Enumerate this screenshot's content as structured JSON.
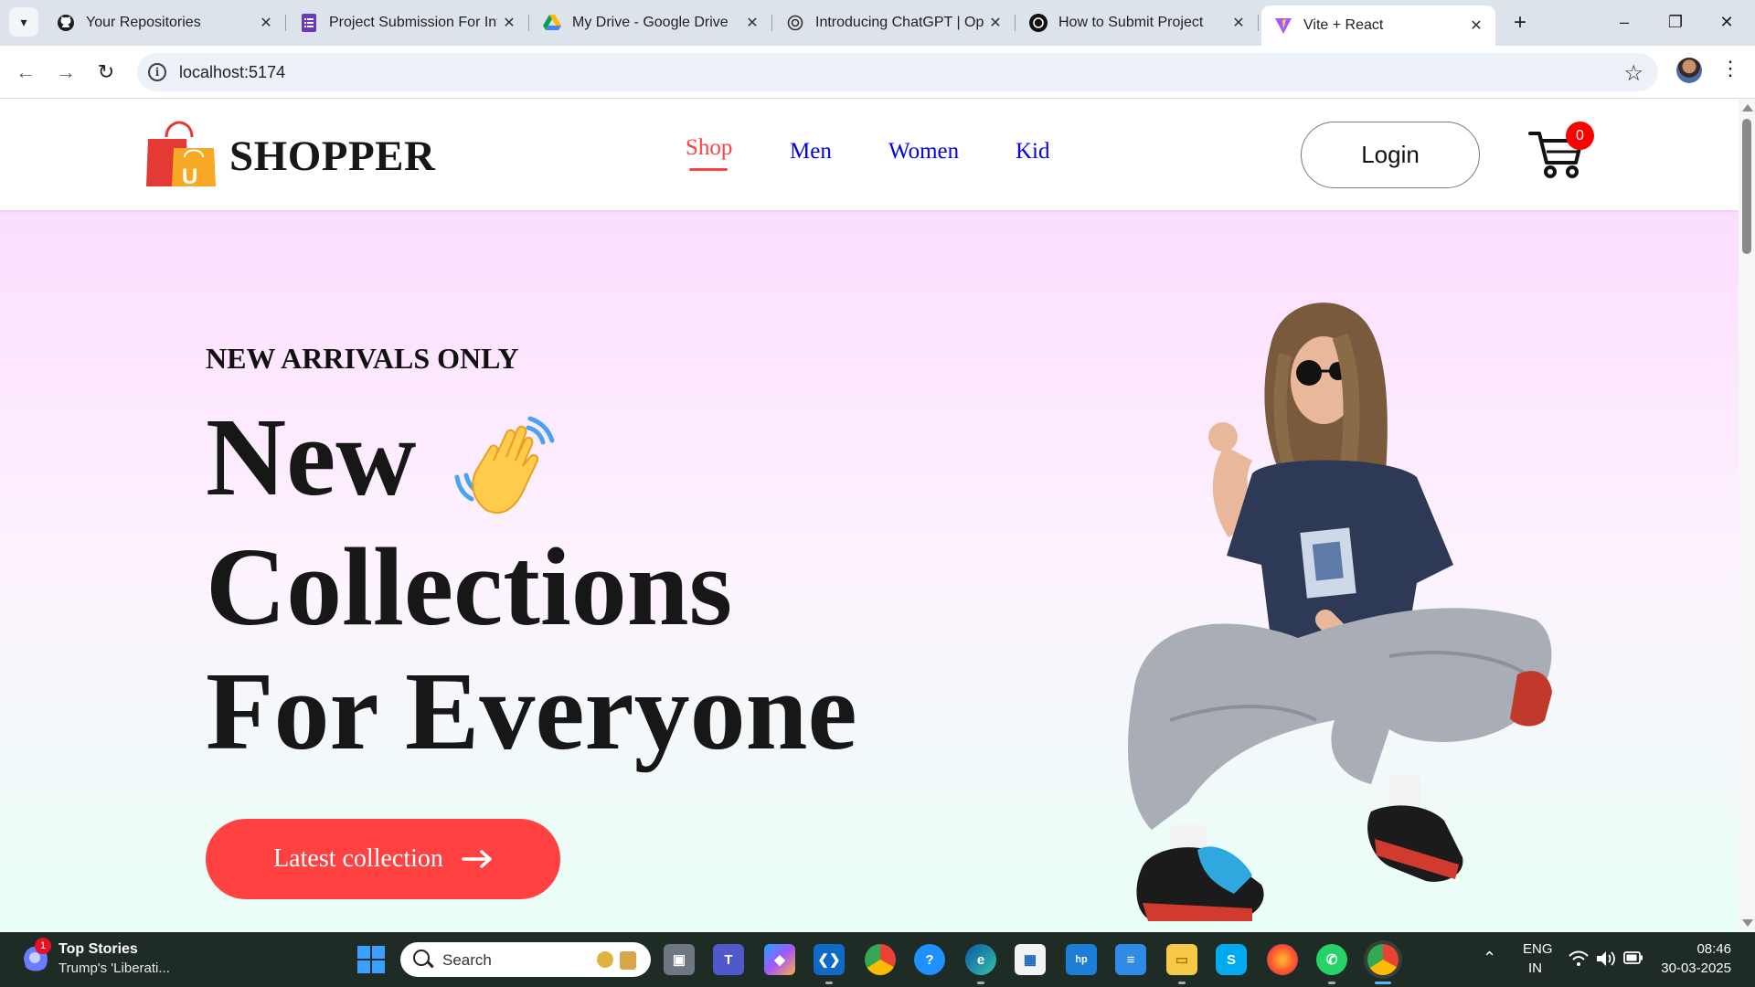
{
  "browser": {
    "tabs": [
      {
        "title": "Your Repositories",
        "icon": "github-icon"
      },
      {
        "title": "Project Submission For Intern",
        "icon": "google-forms-icon"
      },
      {
        "title": "My Drive - Google Drive",
        "icon": "google-drive-icon"
      },
      {
        "title": "Introducing ChatGPT | OpenAI",
        "icon": "openai-icon"
      },
      {
        "title": "How to Submit Project",
        "icon": "chatgpt-icon"
      },
      {
        "title": "Vite + React",
        "icon": "vite-icon",
        "active": true
      }
    ],
    "url": "localhost:5174"
  },
  "site": {
    "brand": "SHOPPER",
    "nav": [
      "Shop",
      "Men",
      "Women",
      "Kid"
    ],
    "active_nav": "Shop",
    "login_label": "Login",
    "cart_count": "0",
    "logo_letter": "U"
  },
  "hero": {
    "kicker": "NEW ARRIVALS ONLY",
    "line1": "New",
    "line2": "Collections",
    "line3": "For Everyone",
    "cta_label": "Latest collection"
  },
  "taskbar": {
    "news_badge": "1",
    "news_title": "Top Stories",
    "news_subtitle": "Trump's 'Liberati...",
    "search_label": "Search",
    "language_line1": "ENG",
    "language_line2": "IN",
    "time": "08:46",
    "date": "30-03-2025"
  },
  "colors": {
    "accent": "#ff4141",
    "link": "#0000ee",
    "hero_top": "#fbdeff",
    "hero_bottom": "#e8fff6"
  }
}
